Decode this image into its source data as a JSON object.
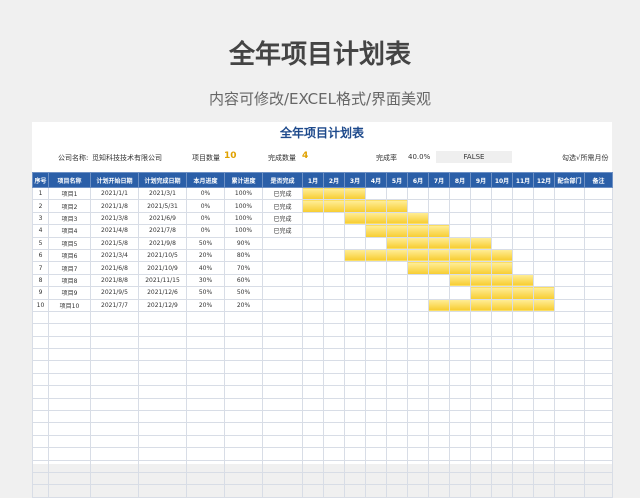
{
  "header": {
    "title": "全年项目计划表",
    "subtitle": "内容可修改/EXCEL格式/界面美观"
  },
  "sheet": {
    "title": "全年项目计划表",
    "company_label": "公司名称:",
    "company_name": "觅知科技技术有限公司",
    "project_count_label": "项目数量",
    "project_count": "10",
    "done_count_label": "完成数量",
    "done_count": "4",
    "done_rate_label": "完成率",
    "done_rate": "40.0%",
    "flag": "FALSE",
    "month_select": "勾选√所需月份"
  },
  "colors": {
    "header_bg": "#2b5fa8",
    "bar": "#f7cc2e",
    "accent": "#e0a100"
  },
  "columns": [
    "序号",
    "项目名称",
    "计划开始日期",
    "计划完成日期",
    "本月进度",
    "累计进度",
    "是否完成",
    "1月",
    "2月",
    "3月",
    "4月",
    "5月",
    "6月",
    "7月",
    "8月",
    "9月",
    "10月",
    "11月",
    "12月",
    "配合部门",
    "备注"
  ],
  "rows": [
    {
      "no": "1",
      "name": "项目1",
      "start": "2021/1/1",
      "end": "2021/3/1",
      "month": "0%",
      "total": "100%",
      "status": "已完成",
      "from": 1,
      "to": 3
    },
    {
      "no": "2",
      "name": "项目2",
      "start": "2021/1/8",
      "end": "2021/5/31",
      "month": "0%",
      "total": "100%",
      "status": "已完成",
      "from": 1,
      "to": 5
    },
    {
      "no": "3",
      "name": "项目3",
      "start": "2021/3/8",
      "end": "2021/6/9",
      "month": "0%",
      "total": "100%",
      "status": "已完成",
      "from": 3,
      "to": 6
    },
    {
      "no": "4",
      "name": "项目4",
      "start": "2021/4/8",
      "end": "2021/7/8",
      "month": "0%",
      "total": "100%",
      "status": "已完成",
      "from": 4,
      "to": 7
    },
    {
      "no": "5",
      "name": "项目5",
      "start": "2021/5/8",
      "end": "2021/9/8",
      "month": "50%",
      "total": "90%",
      "status": "",
      "from": 5,
      "to": 9
    },
    {
      "no": "6",
      "name": "项目6",
      "start": "2021/3/4",
      "end": "2021/10/5",
      "month": "20%",
      "total": "80%",
      "status": "",
      "from": 3,
      "to": 10
    },
    {
      "no": "7",
      "name": "项目7",
      "start": "2021/6/8",
      "end": "2021/10/9",
      "month": "40%",
      "total": "70%",
      "status": "",
      "from": 6,
      "to": 10
    },
    {
      "no": "8",
      "name": "项目8",
      "start": "2021/8/8",
      "end": "2021/11/15",
      "month": "30%",
      "total": "60%",
      "status": "",
      "from": 8,
      "to": 11
    },
    {
      "no": "9",
      "name": "项目9",
      "start": "2021/9/5",
      "end": "2021/12/6",
      "month": "50%",
      "total": "50%",
      "status": "",
      "from": 9,
      "to": 12
    },
    {
      "no": "10",
      "name": "项目10",
      "start": "2021/7/7",
      "end": "2021/12/9",
      "month": "20%",
      "total": "20%",
      "status": "",
      "from": 7,
      "to": 12
    }
  ]
}
